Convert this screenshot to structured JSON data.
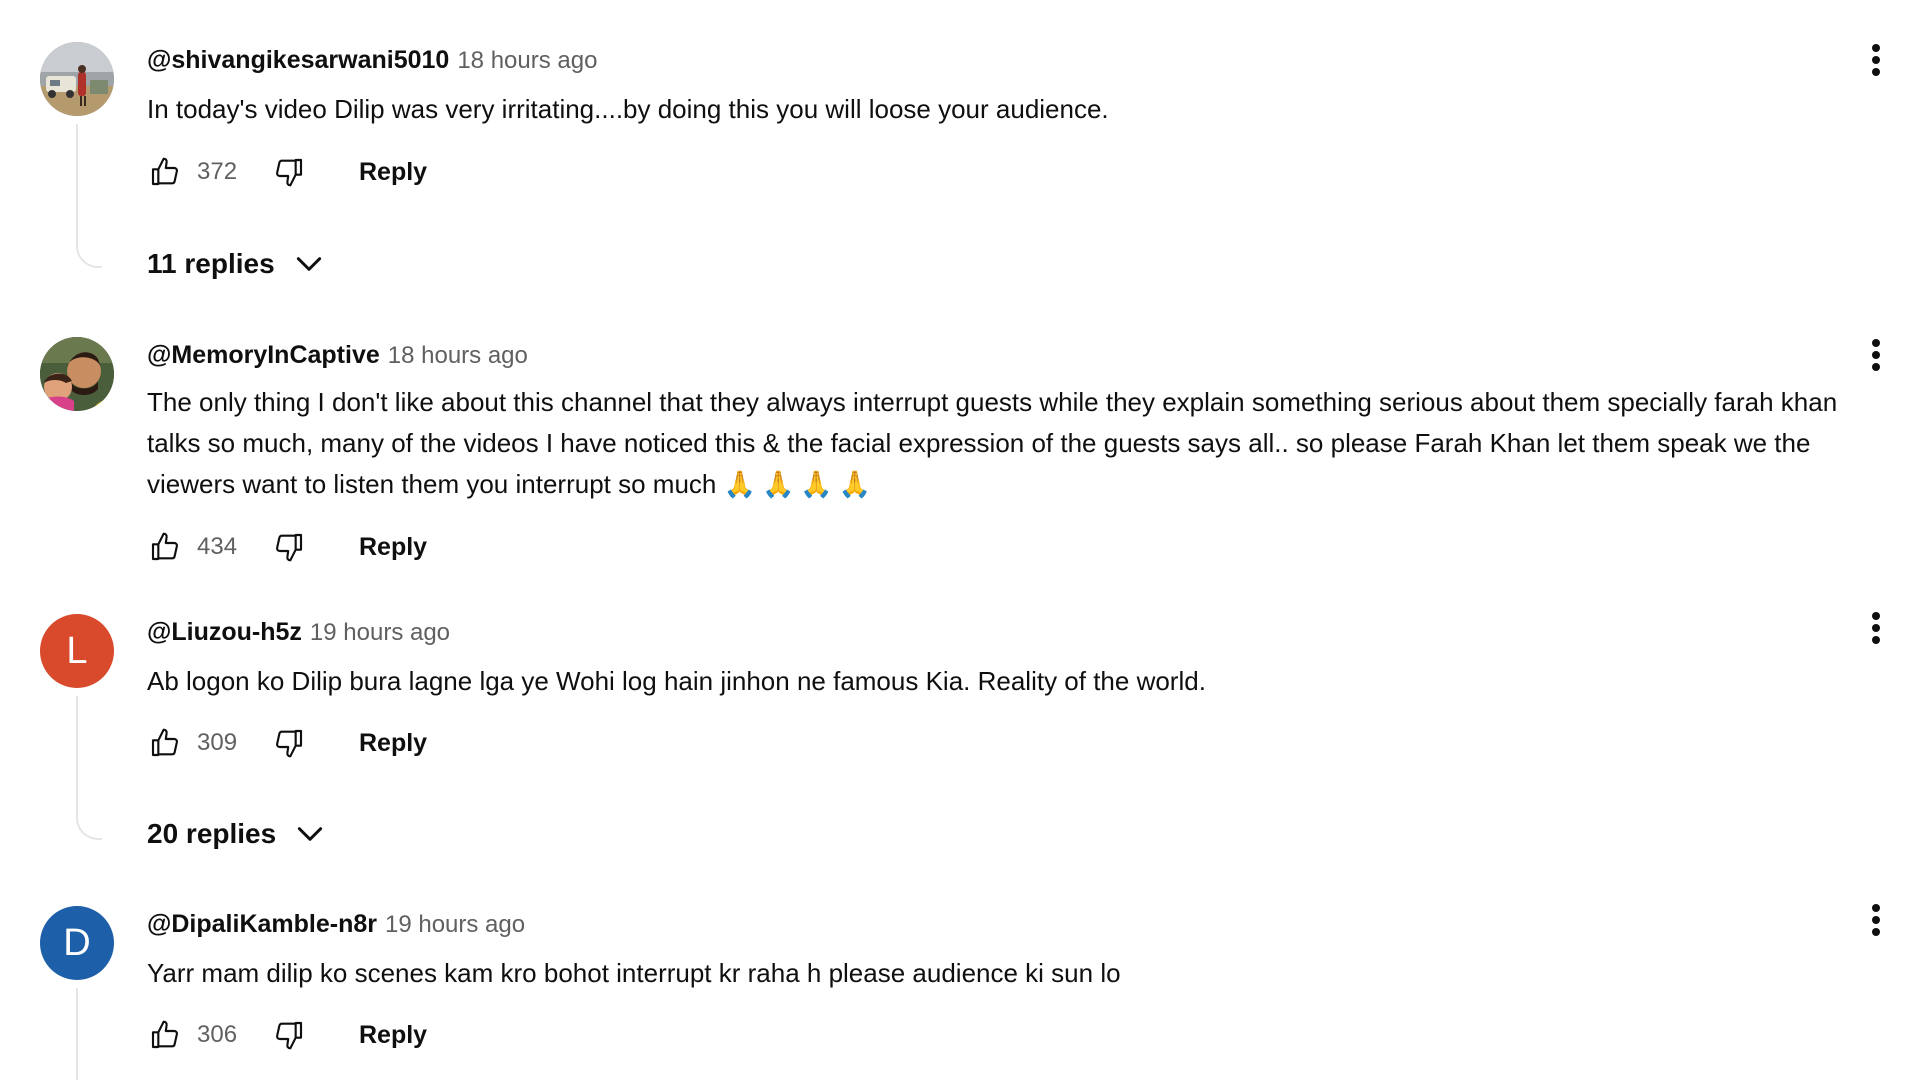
{
  "comments": [
    {
      "author": "@shivangikesarwani5010",
      "time": "18 hours ago",
      "text": "In today's video Dilip was very irritating....by doing this you will loose your audience.",
      "likes": "372",
      "reply_label": "Reply",
      "replies_label": "11 replies",
      "avatar_initial": "",
      "avatar_color": "#8a7a5c"
    },
    {
      "author": "@MemoryInCaptive",
      "time": "18 hours ago",
      "text": "The only thing I don't like about this channel that they always interrupt guests while they explain something serious about them specially farah khan talks so much,  many of the videos I have noticed this & the facial expression of the guests says all.. so please Farah Khan let them speak we the viewers want to listen them you interrupt so much",
      "emoji": "🙏🙏🙏🙏",
      "likes": "434",
      "reply_label": "Reply",
      "avatar_initial": "",
      "avatar_color": "#3d5a3a"
    },
    {
      "author": "@Liuzou-h5z",
      "time": "19 hours ago",
      "text": "Ab logon ko Dilip bura lagne lga ye Wohi log hain jinhon ne famous Kia. Reality of the world.",
      "likes": "309",
      "reply_label": "Reply",
      "replies_label": "20 replies",
      "avatar_initial": "L",
      "avatar_color": "#d84a2b"
    },
    {
      "author": "@DipaliKamble-n8r",
      "time": "19 hours ago",
      "text": "Yarr mam dilip ko scenes kam kro bohot interrupt kr raha h please audience ki sun lo",
      "likes": "306",
      "reply_label": "Reply",
      "avatar_initial": "D",
      "avatar_color": "#1d5fa8"
    }
  ]
}
